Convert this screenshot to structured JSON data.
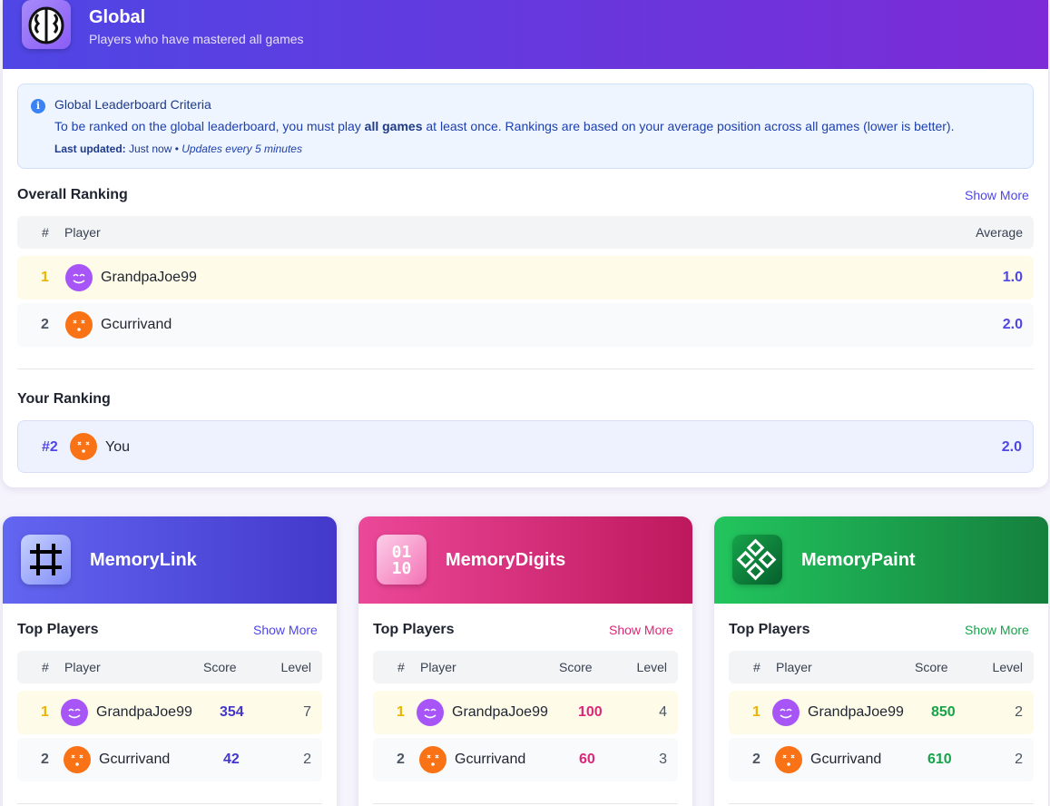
{
  "global": {
    "title": "Global",
    "subtitle": "Players who have mastered all games",
    "criteria": {
      "title": "Global Leaderboard Criteria",
      "text_before": "To be ranked on the global leaderboard, you must play ",
      "text_bold": "all games",
      "text_after": " at least once. Rankings are based on your average position across all games (lower is better).",
      "updated_label": "Last updated:",
      "updated_value": " Just now • ",
      "updated_note": "Updates every 5 minutes"
    },
    "overall": {
      "title": "Overall Ranking",
      "show_more": "Show More",
      "headers": {
        "rank": "#",
        "player": "Player",
        "average": "Average"
      },
      "rows": [
        {
          "rank": "1",
          "name": "GrandpaJoe99",
          "average": "1.0",
          "avatar": "purple-smile"
        },
        {
          "rank": "2",
          "name": "Gcurrivand",
          "average": "2.0",
          "avatar": "orange-dizzy"
        }
      ]
    },
    "yours": {
      "title": "Your Ranking",
      "rank": "#2",
      "name": "You",
      "average": "2.0"
    }
  },
  "games": [
    {
      "title": "MemoryLink",
      "icon": "grid-hash-icon",
      "accent": "#4338ca",
      "header_gradient": [
        "#6366f1",
        "#4338ca"
      ],
      "section_title": "Top Players",
      "show_more": "Show More",
      "headers": {
        "rank": "#",
        "player": "Player",
        "score": "Score",
        "level": "Level"
      },
      "rows": [
        {
          "rank": "1",
          "name": "GrandpaJoe99",
          "score": "354",
          "level": "7"
        },
        {
          "rank": "2",
          "name": "Gcurrivand",
          "score": "42",
          "level": "2"
        }
      ]
    },
    {
      "title": "MemoryDigits",
      "icon": "binary-digits-icon",
      "icon_text_1": "01",
      "icon_text_2": "10",
      "accent": "#db2777",
      "header_gradient": [
        "#ec4899",
        "#be185d"
      ],
      "section_title": "Top Players",
      "show_more": "Show More",
      "headers": {
        "rank": "#",
        "player": "Player",
        "score": "Score",
        "level": "Level"
      },
      "rows": [
        {
          "rank": "1",
          "name": "GrandpaJoe99",
          "score": "100",
          "level": "4"
        },
        {
          "rank": "2",
          "name": "Gcurrivand",
          "score": "60",
          "level": "3"
        }
      ]
    },
    {
      "title": "MemoryPaint",
      "icon": "diamond-pattern-icon",
      "accent": "#16a34a",
      "header_gradient": [
        "#22c55e",
        "#15803d"
      ],
      "section_title": "Top Players",
      "show_more": "Show More",
      "headers": {
        "rank": "#",
        "player": "Player",
        "score": "Score",
        "level": "Level"
      },
      "rows": [
        {
          "rank": "1",
          "name": "GrandpaJoe99",
          "score": "850",
          "level": "2"
        },
        {
          "rank": "2",
          "name": "Gcurrivand",
          "score": "610",
          "level": "2"
        }
      ]
    }
  ]
}
